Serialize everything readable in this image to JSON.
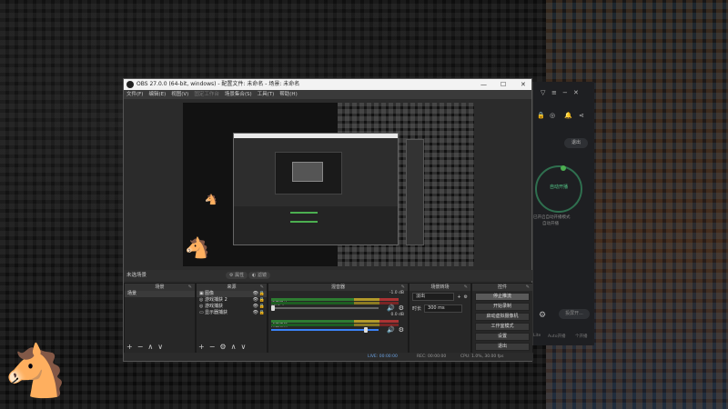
{
  "obs": {
    "title": "OBS 27.0.0 (64-bit, windows) - 配置文件: 未命名 - 场景: 未命名",
    "window_buttons": [
      "—",
      "☐",
      "✕"
    ],
    "menu": [
      {
        "label": "文件(F)",
        "disabled": false
      },
      {
        "label": "编辑(E)",
        "disabled": false
      },
      {
        "label": "视图(V)",
        "disabled": false
      },
      {
        "label": "固定工作台",
        "disabled": true
      },
      {
        "label": "场景集合(S)",
        "disabled": false
      },
      {
        "label": "工具(T)",
        "disabled": false
      },
      {
        "label": "帮助(H)",
        "disabled": false
      }
    ],
    "status_row": {
      "scene_label": "未选场景",
      "properties": "属性",
      "filters": "滤镜"
    },
    "docks": {
      "scenes": {
        "title": "场景",
        "items": [
          "场景"
        ]
      },
      "sources": {
        "title": "来源",
        "items": [
          {
            "icon": "image",
            "label": "图像"
          },
          {
            "icon": "game",
            "label": "游戏捕获 2"
          },
          {
            "icon": "game",
            "label": "游戏捕获"
          },
          {
            "icon": "display",
            "label": "显示器捕获"
          }
        ]
      },
      "mixer": {
        "title": "混音器",
        "channels": [
          {
            "name": "麦克风/Aux",
            "db": "-1.0 dB"
          },
          {
            "name": "桌面音频",
            "db": "0.0 dB"
          }
        ]
      },
      "transitions": {
        "title": "场景转场",
        "type": "淡出",
        "duration_label": "时长",
        "duration_value": "300 ms"
      },
      "controls": {
        "title": "控件",
        "buttons": [
          "停止推流",
          "开始录制",
          "启动虚拟摄像机",
          "工作室模式",
          "设置",
          "退出"
        ]
      }
    },
    "statusbar": {
      "live": "LIVE: 00:00:00",
      "rec": "REC: 00:00:00",
      "cpu": "CPU: 1.0%, 30.00 fps"
    }
  },
  "side_app": {
    "exit_label": "退出",
    "status_label": "自动开播",
    "caption_line1": "已开启自动开播模式",
    "caption_line2": "自动开播",
    "screen_button": "投屏开...",
    "footer": [
      "Lite",
      "Auto开播",
      "个开播"
    ]
  }
}
